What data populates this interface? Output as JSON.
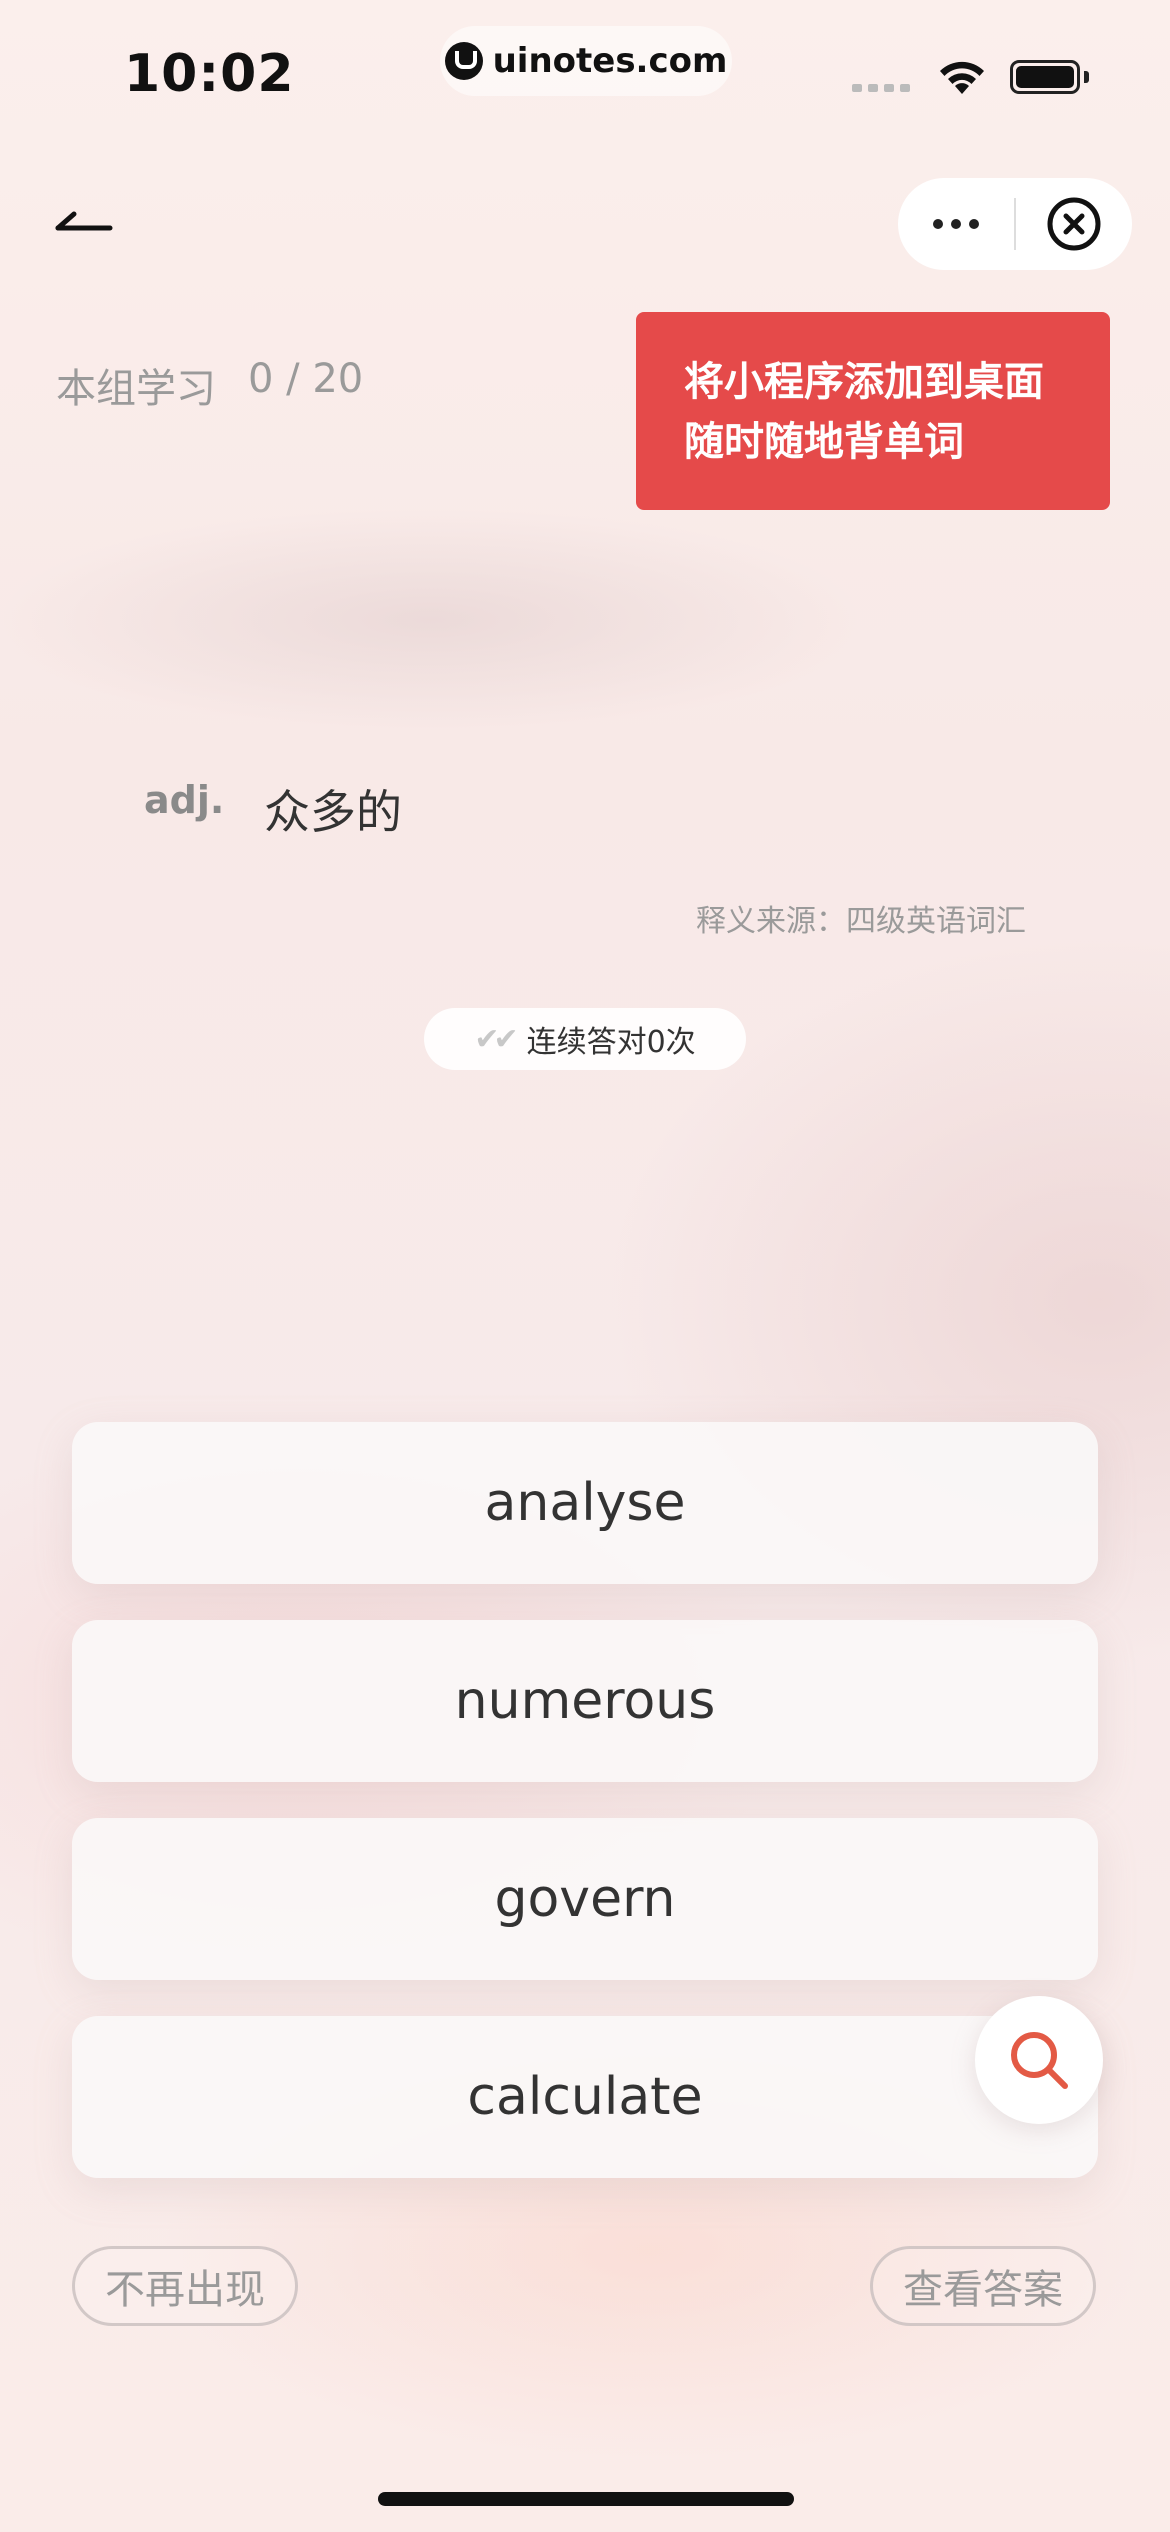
{
  "status_bar": {
    "time": "10:02",
    "url": "uinotes.com"
  },
  "progress": {
    "label": "本组学习",
    "count": "0 / 20"
  },
  "banner": {
    "line1": "将小程序添加到桌面",
    "line2": "随时随地背单词"
  },
  "word": {
    "part_of_speech": "adj.",
    "meaning": "众多的",
    "source": "释义来源：四级英语词汇"
  },
  "streak": {
    "checks": "✔✔",
    "text": "连续答对0次"
  },
  "options": [
    "analyse",
    "numerous",
    "govern",
    "calculate"
  ],
  "actions": {
    "hide": "不再出现",
    "show_answer": "查看答案"
  },
  "colors": {
    "accent_red": "#e54a4a",
    "search_icon": "#e35a45"
  },
  "icons": {
    "back": "back-arrow-icon",
    "more": "more-dots-icon",
    "close": "close-circle-icon",
    "search": "search-icon"
  }
}
